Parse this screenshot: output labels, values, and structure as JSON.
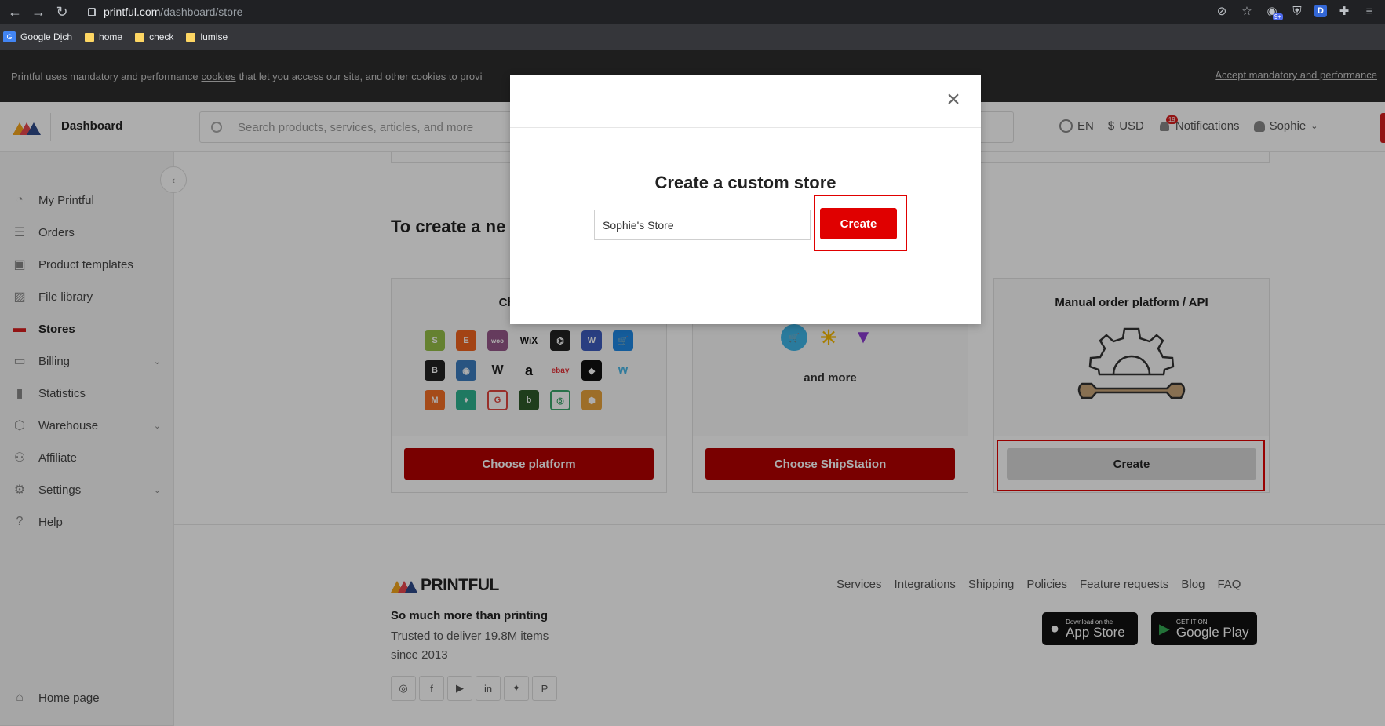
{
  "browser": {
    "url_host": "printful.com",
    "url_path": "/dashboard/store",
    "bookmarks": [
      "Google Dịch",
      "home",
      "check",
      "lumise"
    ],
    "ext_badge": "9+",
    "ext_d": "D"
  },
  "cookie_bar": {
    "text_before": "Printful uses mandatory and performance",
    "link": "cookies",
    "text_after": "that let you access our site, and other cookies to provi",
    "accept": "Accept mandatory and performance"
  },
  "header": {
    "title": "Dashboard",
    "search_placeholder": "Search products, services, articles, and more",
    "lang": "EN",
    "currency": "USD",
    "currency_symbol": "$",
    "notifications_label": "Notifications",
    "notifications_count": "19",
    "user": "Sophie"
  },
  "sidebar": {
    "items": [
      {
        "label": "My Printful",
        "icon": "pie-chart-icon"
      },
      {
        "label": "Orders",
        "icon": "list-icon"
      },
      {
        "label": "Product templates",
        "icon": "template-icon"
      },
      {
        "label": "File library",
        "icon": "image-icon"
      },
      {
        "label": "Stores",
        "icon": "store-icon",
        "active": true
      },
      {
        "label": "Billing",
        "icon": "card-icon",
        "expandable": true
      },
      {
        "label": "Statistics",
        "icon": "bar-chart-icon"
      },
      {
        "label": "Warehouse",
        "icon": "box-icon",
        "expandable": true
      },
      {
        "label": "Affiliate",
        "icon": "people-icon"
      },
      {
        "label": "Settings",
        "icon": "gear-icon",
        "expandable": true
      },
      {
        "label": "Help",
        "icon": "help-icon"
      }
    ],
    "home_page": "Home page"
  },
  "main": {
    "heading": "To create a ne",
    "card1": {
      "title": "Choose yo",
      "button": "Choose platform"
    },
    "card2": {
      "and_more": "and more",
      "button": "Choose ShipStation"
    },
    "card3": {
      "title": "Manual order platform / API",
      "button": "Create"
    }
  },
  "footer": {
    "brand": "PRINTFUL",
    "tagline": "So much more than printing",
    "trusted": "Trusted to deliver 19.8M items since 2013",
    "links": [
      "Services",
      "Integrations",
      "Shipping",
      "Policies",
      "Feature requests",
      "Blog",
      "FAQ"
    ],
    "app_store_small": "Download on the",
    "app_store_big": "App Store",
    "google_small": "GET IT ON",
    "google_big": "Google Play"
  },
  "modal": {
    "title": "Create a custom store",
    "input_value": "Sophie's Store",
    "create_label": "Create",
    "close_glyph": "×"
  },
  "colors": {
    "accent_red": "#e00000",
    "dark_red": "#b30000",
    "highlight": "#e00000"
  }
}
